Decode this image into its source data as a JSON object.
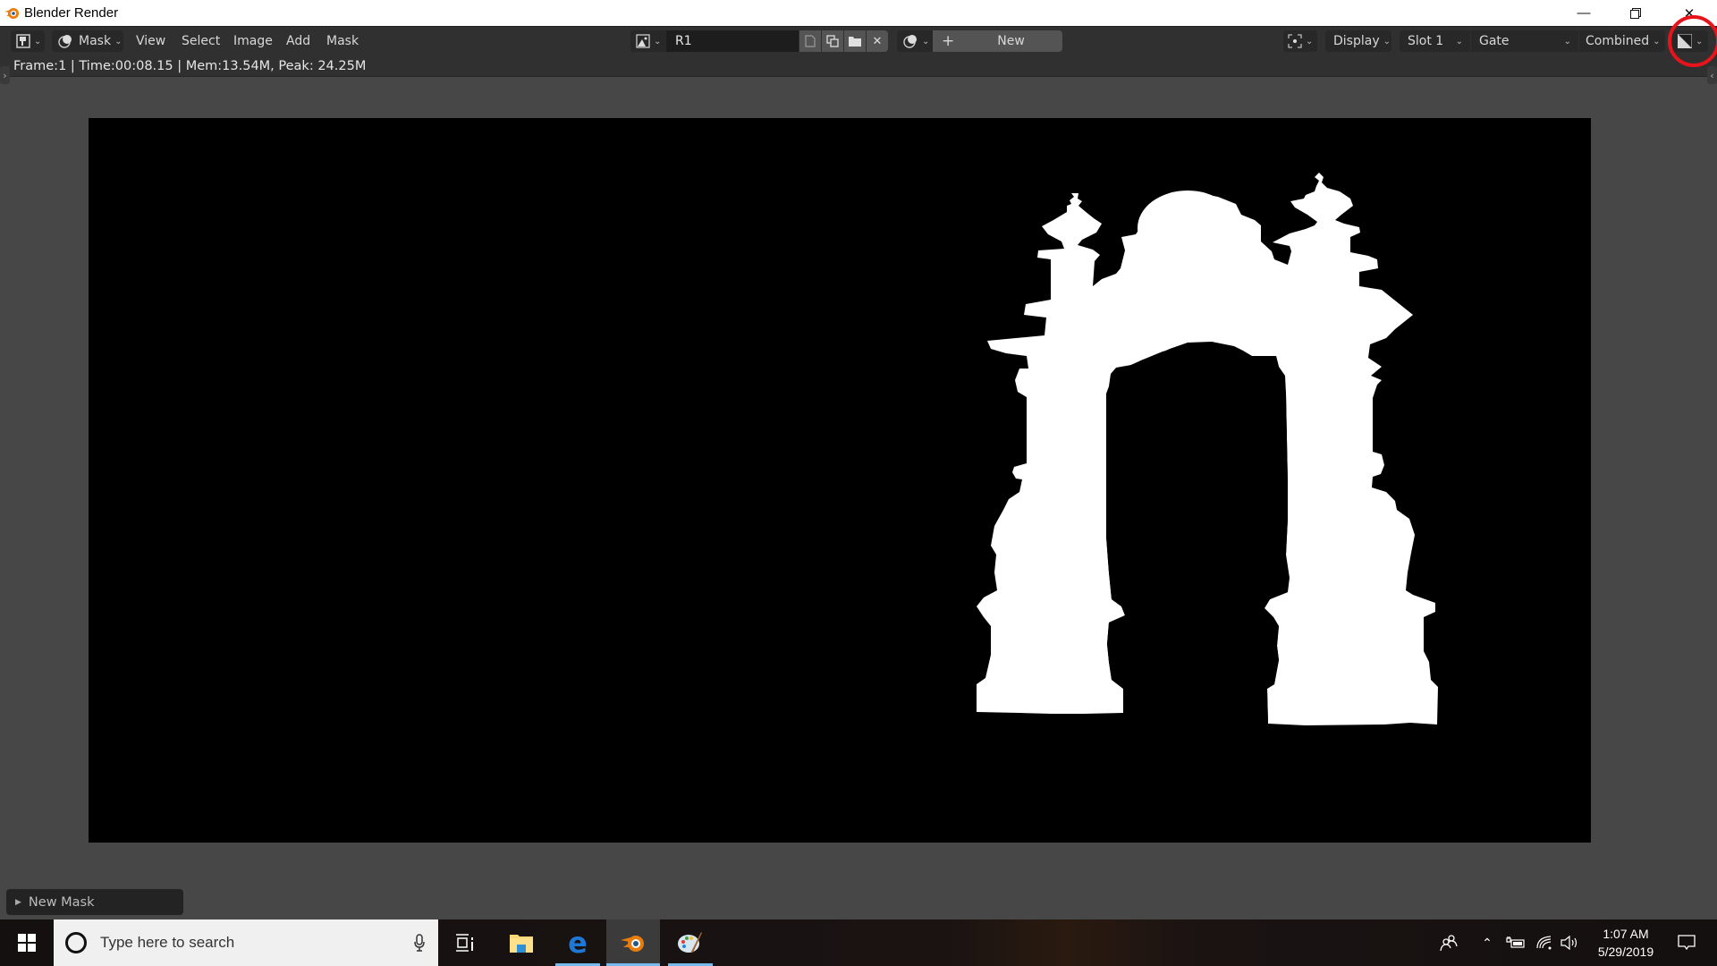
{
  "window": {
    "title": "Blender Render",
    "controls": [
      "minimize",
      "restore",
      "close"
    ]
  },
  "header": {
    "editor_type_icon": "image-editor-icon",
    "mode": {
      "icon": "mask-mode-icon",
      "label": "Mask"
    },
    "menus": [
      "View",
      "Select",
      "Image",
      "Add",
      "Mask"
    ],
    "image_browse_icon": "image-icon",
    "image_name": "R1",
    "image_actions": [
      "fake-user-icon",
      "duplicate-icon",
      "open-folder-icon",
      "unlink-icon"
    ],
    "mask_browse_icon": "mask-icon",
    "new_mask": {
      "icon": "plus-icon",
      "label": "New"
    },
    "pivot_icon": "pivot-icon",
    "display_label": "Display",
    "slot_label": "Slot 1",
    "layer_label": "Gate",
    "pass_label": "Combined",
    "display_channels_icon": "color-alpha-icon"
  },
  "status": {
    "text": "Frame:1 | Time:00:08.15 | Mem:13.54M, Peak: 24.25M"
  },
  "panel": {
    "new_mask_label": "New Mask"
  },
  "render": {
    "background_color": "#000000",
    "silhouette_color": "#ffffff",
    "subject": "gate"
  },
  "annotation": {
    "color": "#e8141c",
    "target": "display-channels-dropdown"
  },
  "taskbar": {
    "search_placeholder": "Type here to search",
    "pinned": [
      "task-view-icon",
      "file-explorer-icon",
      "edge-icon",
      "blender-icon",
      "paint-icon"
    ],
    "active": [
      "edge-icon",
      "blender-icon",
      "paint-icon"
    ],
    "clock_time": "1:07 AM",
    "clock_date": "5/29/2019"
  }
}
